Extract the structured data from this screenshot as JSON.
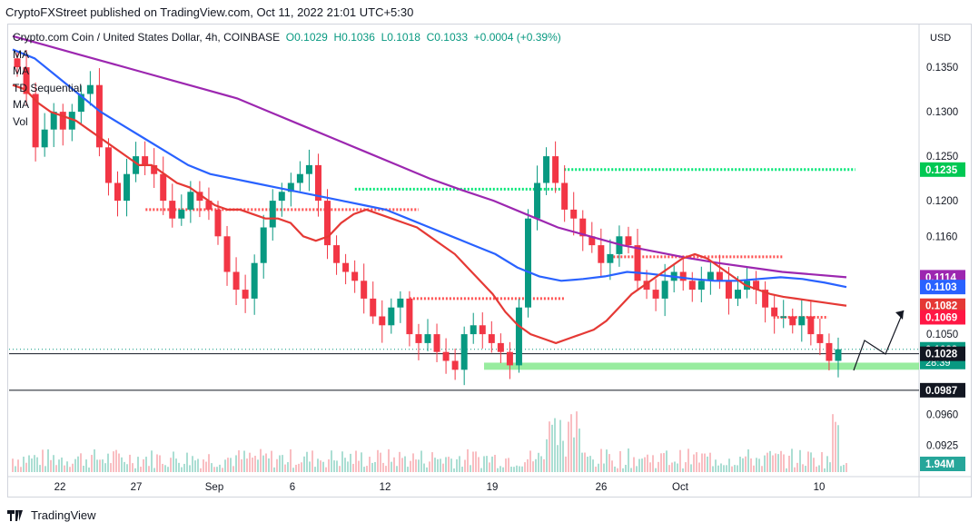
{
  "header": {
    "published": "CryptoFXStreet published on TradingView.com, Oct 11, 2022 21:01 UTC+5:30"
  },
  "legend": {
    "symbol": "Crypto.com Coin / United States Dollar, 4h, COINBASE",
    "open": "O0.1029",
    "high": "H0.1036",
    "low": "L0.1018",
    "close": "C0.1033",
    "change": "+0.0004 (+0.39%)",
    "indicators": [
      "MA",
      "MA",
      "TD Sequential",
      "MA",
      "Vol"
    ]
  },
  "footer": {
    "brand": "TradingView"
  },
  "colors": {
    "up": "#089981",
    "down": "#f23645",
    "ma_red": "#e53935",
    "ma_blue": "#2962ff",
    "ma_purple": "#9c27b0",
    "green_level": "#00e676",
    "red_level": "#ff5252",
    "zone": "#7ee787"
  },
  "chart_data": {
    "type": "candlestick",
    "currency": "USD",
    "timeframe": "4h",
    "x_tick_labels": [
      "22",
      "27",
      "Sep",
      "6",
      "12",
      "19",
      "26",
      "Oct",
      "10"
    ],
    "y_ticks": [
      0.135,
      0.13,
      0.125,
      0.12,
      0.116,
      0.105,
      0.096,
      0.0925
    ],
    "y_range": [
      0.0895,
      0.1395
    ],
    "price_labels": [
      {
        "value": "0.1235",
        "kind": "level-green"
      },
      {
        "value": "0.1114",
        "kind": "ma-purple"
      },
      {
        "value": "0.1103",
        "kind": "ma-blue"
      },
      {
        "value": "0.1082",
        "kind": "ma-red"
      },
      {
        "value": "0.1069",
        "kind": "level-red"
      },
      {
        "value": "0.1033",
        "kind": "last-price",
        "countdown": "28:39"
      },
      {
        "value": "0.1028",
        "kind": "level-black"
      },
      {
        "value": "0.0987",
        "kind": "level-black"
      },
      {
        "value": "1.94M",
        "kind": "volume"
      }
    ],
    "levels": [
      {
        "price": 0.1235,
        "from": 0.61,
        "to": 0.93,
        "color": "green"
      },
      {
        "price": 0.1213,
        "from": 0.38,
        "to": 0.61,
        "color": "green"
      },
      {
        "price": 0.119,
        "from": 0.15,
        "to": 0.45,
        "color": "red"
      },
      {
        "price": 0.1137,
        "from": 0.66,
        "to": 0.85,
        "color": "red"
      },
      {
        "price": 0.109,
        "from": 0.44,
        "to": 0.61,
        "color": "red"
      },
      {
        "price": 0.1069,
        "from": 0.84,
        "to": 0.9,
        "color": "red"
      }
    ],
    "horizontal_lines": [
      0.1028,
      0.0987
    ],
    "support_zone": [
      0.101,
      0.1018
    ],
    "close_series": [
      0.135,
      0.132,
      0.126,
      0.128,
      0.13,
      0.128,
      0.13,
      0.132,
      0.133,
      0.126,
      0.122,
      0.12,
      0.123,
      0.125,
      0.124,
      0.123,
      0.12,
      0.118,
      0.119,
      0.121,
      0.12,
      0.119,
      0.116,
      0.112,
      0.11,
      0.109,
      0.113,
      0.117,
      0.12,
      0.121,
      0.122,
      0.123,
      0.124,
      0.12,
      0.115,
      0.113,
      0.112,
      0.111,
      0.109,
      0.107,
      0.106,
      0.108,
      0.109,
      0.105,
      0.104,
      0.105,
      0.103,
      0.102,
      0.101,
      0.105,
      0.106,
      0.105,
      0.104,
      0.103,
      0.1015,
      0.108,
      0.118,
      0.122,
      0.125,
      0.122,
      0.119,
      0.118,
      0.116,
      0.115,
      0.113,
      0.114,
      0.116,
      0.115,
      0.111,
      0.11,
      0.109,
      0.111,
      0.112,
      0.111,
      0.11,
      0.111,
      0.112,
      0.111,
      0.109,
      0.11,
      0.111,
      0.11,
      0.108,
      0.107,
      0.107,
      0.106,
      0.107,
      0.105,
      0.104,
      0.102,
      0.1033
    ],
    "ma_red": [
      0.133,
      0.1325,
      0.131,
      0.13,
      0.1295,
      0.129,
      0.128,
      0.127,
      0.126,
      0.125,
      0.124,
      0.124,
      0.123,
      0.122,
      0.1215,
      0.1205,
      0.1195,
      0.119,
      0.119,
      0.1185,
      0.118,
      0.118,
      0.1175,
      0.116,
      0.1155,
      0.116,
      0.1175,
      0.1185,
      0.119,
      0.1185,
      0.118,
      0.1175,
      0.117,
      0.116,
      0.115,
      0.114,
      0.1125,
      0.111,
      0.1095,
      0.1075,
      0.106,
      0.105,
      0.1045,
      0.104,
      0.1045,
      0.105,
      0.1055,
      0.1065,
      0.108,
      0.1095,
      0.1105,
      0.1115,
      0.1125,
      0.1135,
      0.114,
      0.1135,
      0.1125,
      0.1115,
      0.1105,
      0.11,
      0.1095,
      0.1092,
      0.109,
      0.1088,
      0.1086,
      0.1084,
      0.1082
    ],
    "ma_blue": [
      0.137,
      0.136,
      0.134,
      0.132,
      0.13,
      0.1285,
      0.127,
      0.1255,
      0.124,
      0.123,
      0.1225,
      0.122,
      0.1215,
      0.121,
      0.1205,
      0.12,
      0.1195,
      0.119,
      0.118,
      0.117,
      0.116,
      0.115,
      0.114,
      0.1125,
      0.1115,
      0.111,
      0.1112,
      0.1115,
      0.112,
      0.1118,
      0.1115,
      0.1112,
      0.111,
      0.111,
      0.1112,
      0.1114,
      0.1112,
      0.1108,
      0.1103
    ],
    "ma_purple": [
      0.1385,
      0.1375,
      0.1365,
      0.1355,
      0.1345,
      0.1335,
      0.1325,
      0.1315,
      0.13,
      0.1285,
      0.127,
      0.1255,
      0.124,
      0.1225,
      0.1212,
      0.12,
      0.1185,
      0.117,
      0.116,
      0.115,
      0.1143,
      0.1136,
      0.113,
      0.1125,
      0.112,
      0.1117,
      0.1114
    ]
  }
}
